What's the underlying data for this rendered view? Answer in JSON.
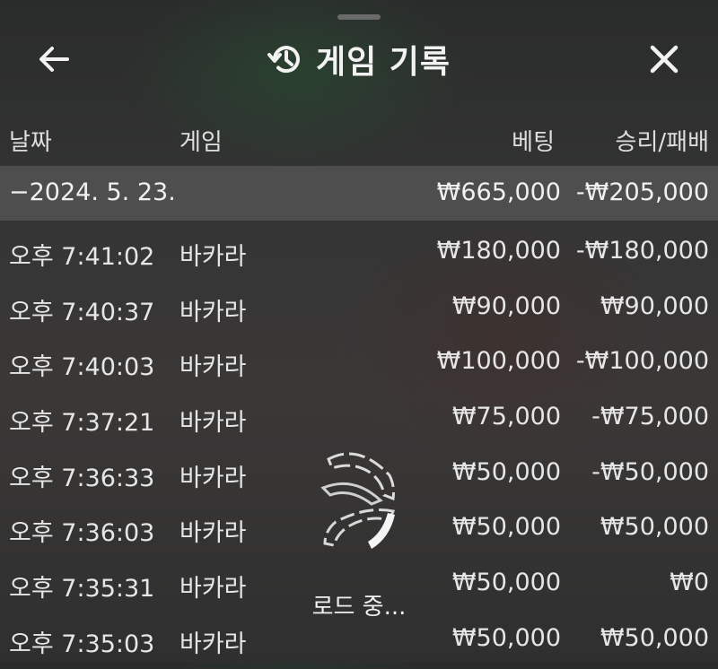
{
  "header": {
    "title": "게임 기록",
    "back_icon": "arrow-left-icon",
    "history_icon": "history-icon",
    "close_icon": "close-icon"
  },
  "columns": {
    "date": "날짜",
    "game": "게임",
    "bet": "베팅",
    "win_loss": "승리/패배"
  },
  "day_summary": {
    "date": "−2024. 5. 23.",
    "bet": "₩665,000",
    "win_loss": "-₩205,000"
  },
  "rows": [
    {
      "time": "오후 7:41:02",
      "game": "바카라",
      "bet": "₩180,000",
      "win_loss": "-₩180,000"
    },
    {
      "time": "오후 7:40:37",
      "game": "바카라",
      "bet": "₩90,000",
      "win_loss": "₩90,000"
    },
    {
      "time": "오후 7:40:03",
      "game": "바카라",
      "bet": "₩100,000",
      "win_loss": "-₩100,000"
    },
    {
      "time": "오후 7:37:21",
      "game": "바카라",
      "bet": "₩75,000",
      "win_loss": "-₩75,000"
    },
    {
      "time": "오후 7:36:33",
      "game": "바카라",
      "bet": "₩50,000",
      "win_loss": "-₩50,000"
    },
    {
      "time": "오후 7:36:03",
      "game": "바카라",
      "bet": "₩50,000",
      "win_loss": "₩50,000"
    },
    {
      "time": "오후 7:35:31",
      "game": "바카라",
      "bet": "₩50,000",
      "win_loss": "₩0"
    },
    {
      "time": "오후 7:35:03",
      "game": "바카라",
      "bet": "₩50,000",
      "win_loss": "₩50,000"
    }
  ],
  "loading": {
    "text": "로드 중...",
    "icon": "loading-spinner-icon"
  },
  "colors": {
    "text": "#e8e8e8",
    "summary_row": "#5e5e5e",
    "background": "#333333"
  }
}
